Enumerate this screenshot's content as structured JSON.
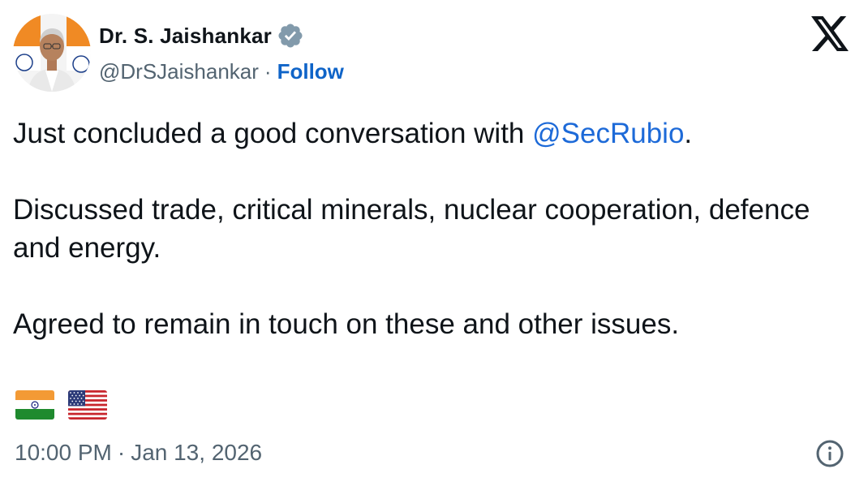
{
  "author": {
    "name": "Dr. S. Jaishankar",
    "handle": "@DrSJaishankar",
    "separator": "·",
    "follow_label": "Follow",
    "verified": true,
    "verified_color": "#829aab"
  },
  "tweet": {
    "line1_prefix": "Just concluded a good conversation with ",
    "mention": "@SecRubio",
    "line1_suffix": ".",
    "paragraph2": "Discussed trade, critical minerals, nuclear cooperation, defence and energy.",
    "paragraph3": "Agreed to remain in touch on these and other issues.",
    "flags": [
      "flag-india-icon",
      "flag-usa-icon"
    ]
  },
  "meta": {
    "time": "10:00 PM",
    "separator": "·",
    "date": "Jan 13, 2026"
  },
  "icons": {
    "platform_logo": "x-logo-icon",
    "info": "info-icon"
  },
  "colors": {
    "text": "#0f1419",
    "secondary": "#536471",
    "link": "#1d6ad8",
    "follow": "#0f64c8"
  }
}
